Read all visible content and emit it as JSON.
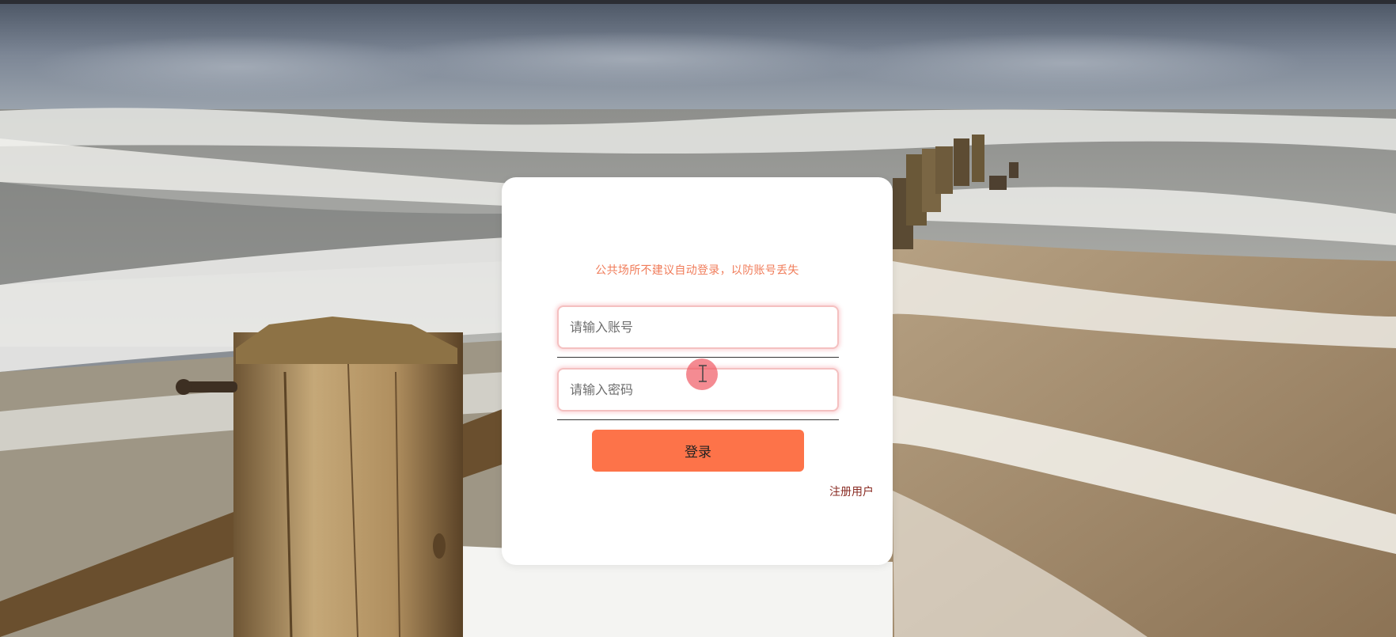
{
  "login": {
    "notice": "公共场所不建议自动登录，以防账号丢失",
    "account_placeholder": "请输入账号",
    "password_placeholder": "请输入密码",
    "login_label": "登录",
    "register_label": "注册用户"
  },
  "colors": {
    "accent": "#fd7349",
    "notice": "#f07c5a",
    "register": "#8a2c24",
    "input_border": "#f4c0c0"
  },
  "icons": {
    "cursor": "text-cursor-icon"
  }
}
